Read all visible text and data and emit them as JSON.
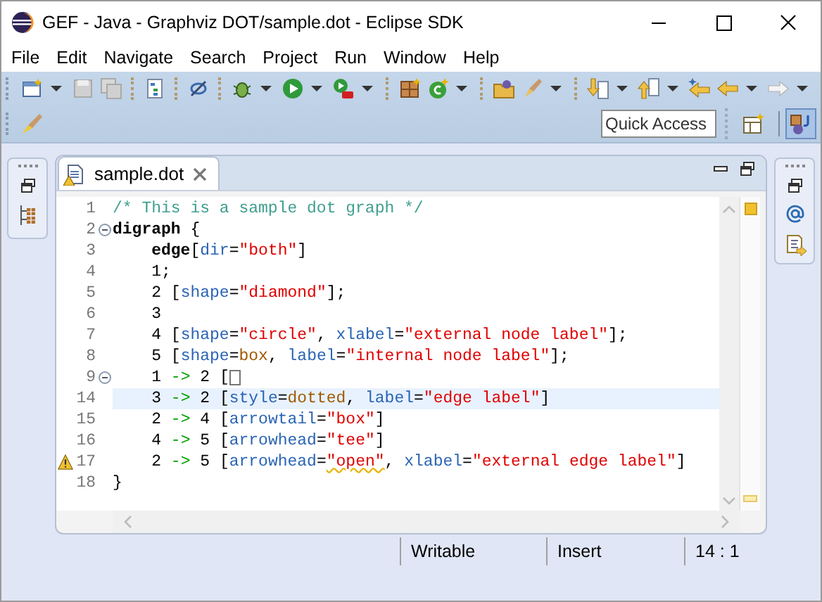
{
  "window": {
    "title": "GEF - Java - Graphviz DOT/sample.dot - Eclipse SDK"
  },
  "menu": [
    "File",
    "Edit",
    "Navigate",
    "Search",
    "Project",
    "Run",
    "Window",
    "Help"
  ],
  "quick_access": {
    "placeholder": "Quick Access"
  },
  "perspectives": [
    {
      "selected": false
    },
    {
      "selected": true
    }
  ],
  "editor": {
    "tab": {
      "label": "sample.dot",
      "warning": true
    },
    "lines": [
      {
        "number": "1",
        "fold": false,
        "warning": false,
        "current": false,
        "tokens": [
          {
            "kind": "comment",
            "text": "/* This is a sample dot graph */"
          }
        ]
      },
      {
        "number": "2",
        "fold": true,
        "warning": false,
        "current": false,
        "tokens": [
          {
            "kind": "keyword",
            "text": "digraph"
          },
          {
            "kind": "plain",
            "text": " {"
          }
        ]
      },
      {
        "number": "3",
        "fold": false,
        "warning": false,
        "current": false,
        "tokens": [
          {
            "kind": "keyword",
            "text": "    edge"
          },
          {
            "kind": "plain",
            "text": "["
          },
          {
            "kind": "attr",
            "text": "dir"
          },
          {
            "kind": "plain",
            "text": "="
          },
          {
            "kind": "string",
            "text": "\"both\""
          },
          {
            "kind": "plain",
            "text": "]"
          }
        ]
      },
      {
        "number": "4",
        "fold": false,
        "warning": false,
        "current": false,
        "tokens": [
          {
            "kind": "plain",
            "text": "    1;"
          }
        ]
      },
      {
        "number": "5",
        "fold": false,
        "warning": false,
        "current": false,
        "tokens": [
          {
            "kind": "plain",
            "text": "    2 ["
          },
          {
            "kind": "attr",
            "text": "shape"
          },
          {
            "kind": "plain",
            "text": "="
          },
          {
            "kind": "string",
            "text": "\"diamond\""
          },
          {
            "kind": "plain",
            "text": "];"
          }
        ]
      },
      {
        "number": "6",
        "fold": false,
        "warning": false,
        "current": false,
        "tokens": [
          {
            "kind": "plain",
            "text": "    3"
          }
        ]
      },
      {
        "number": "7",
        "fold": false,
        "warning": false,
        "current": false,
        "tokens": [
          {
            "kind": "plain",
            "text": "    4 ["
          },
          {
            "kind": "attr",
            "text": "shape"
          },
          {
            "kind": "plain",
            "text": "="
          },
          {
            "kind": "string",
            "text": "\"circle\""
          },
          {
            "kind": "plain",
            "text": ", "
          },
          {
            "kind": "attr",
            "text": "xlabel"
          },
          {
            "kind": "plain",
            "text": "="
          },
          {
            "kind": "string",
            "text": "\"external node label\""
          },
          {
            "kind": "plain",
            "text": "];"
          }
        ]
      },
      {
        "number": "8",
        "fold": false,
        "warning": false,
        "current": false,
        "tokens": [
          {
            "kind": "plain",
            "text": "    5 ["
          },
          {
            "kind": "attr",
            "text": "shape"
          },
          {
            "kind": "plain",
            "text": "="
          },
          {
            "kind": "value",
            "text": "box"
          },
          {
            "kind": "plain",
            "text": ", "
          },
          {
            "kind": "attr",
            "text": "label"
          },
          {
            "kind": "plain",
            "text": "="
          },
          {
            "kind": "string",
            "text": "\"internal node label\""
          },
          {
            "kind": "plain",
            "text": "];"
          }
        ]
      },
      {
        "number": "9",
        "fold": true,
        "warning": false,
        "current": false,
        "tokens": [
          {
            "kind": "plain",
            "text": "    1 "
          },
          {
            "kind": "arrow",
            "text": "->"
          },
          {
            "kind": "plain",
            "text": " 2 ["
          },
          {
            "kind": "collapsed"
          }
        ]
      },
      {
        "number": "14",
        "fold": false,
        "warning": false,
        "current": true,
        "tokens": [
          {
            "kind": "plain",
            "text": "    3 "
          },
          {
            "kind": "arrow",
            "text": "->"
          },
          {
            "kind": "plain",
            "text": " 2 ["
          },
          {
            "kind": "attr",
            "text": "style"
          },
          {
            "kind": "plain",
            "text": "="
          },
          {
            "kind": "value",
            "text": "dotted"
          },
          {
            "kind": "plain",
            "text": ", "
          },
          {
            "kind": "attr",
            "text": "label"
          },
          {
            "kind": "plain",
            "text": "="
          },
          {
            "kind": "string",
            "text": "\"edge label\""
          },
          {
            "kind": "plain",
            "text": "]"
          }
        ]
      },
      {
        "number": "15",
        "fold": false,
        "warning": false,
        "current": false,
        "tokens": [
          {
            "kind": "plain",
            "text": "    2 "
          },
          {
            "kind": "arrow",
            "text": "->"
          },
          {
            "kind": "plain",
            "text": " 4 ["
          },
          {
            "kind": "attr",
            "text": "arrowtail"
          },
          {
            "kind": "plain",
            "text": "="
          },
          {
            "kind": "string",
            "text": "\"box\""
          },
          {
            "kind": "plain",
            "text": "]"
          }
        ]
      },
      {
        "number": "16",
        "fold": false,
        "warning": false,
        "current": false,
        "tokens": [
          {
            "kind": "plain",
            "text": "    4 "
          },
          {
            "kind": "arrow",
            "text": "->"
          },
          {
            "kind": "plain",
            "text": " 5 ["
          },
          {
            "kind": "attr",
            "text": "arrowhead"
          },
          {
            "kind": "plain",
            "text": "="
          },
          {
            "kind": "string",
            "text": "\"tee\""
          },
          {
            "kind": "plain",
            "text": "]"
          }
        ]
      },
      {
        "number": "17",
        "fold": false,
        "warning": true,
        "current": false,
        "tokens": [
          {
            "kind": "plain",
            "text": "    2 "
          },
          {
            "kind": "arrow",
            "text": "->"
          },
          {
            "kind": "plain",
            "text": " 5 ["
          },
          {
            "kind": "attr",
            "text": "arrowhead"
          },
          {
            "kind": "plain",
            "text": "="
          },
          {
            "kind": "warned_string",
            "text": "\"open\""
          },
          {
            "kind": "plain",
            "text": ", "
          },
          {
            "kind": "attr",
            "text": "xlabel"
          },
          {
            "kind": "plain",
            "text": "="
          },
          {
            "kind": "string",
            "text": "\"external edge label\""
          },
          {
            "kind": "plain",
            "text": "]"
          }
        ]
      },
      {
        "number": "18",
        "fold": false,
        "warning": false,
        "current": false,
        "tokens": [
          {
            "kind": "plain",
            "text": "}"
          }
        ]
      }
    ]
  },
  "status_bar": [
    "Writable",
    "Insert",
    "14 : 1"
  ]
}
